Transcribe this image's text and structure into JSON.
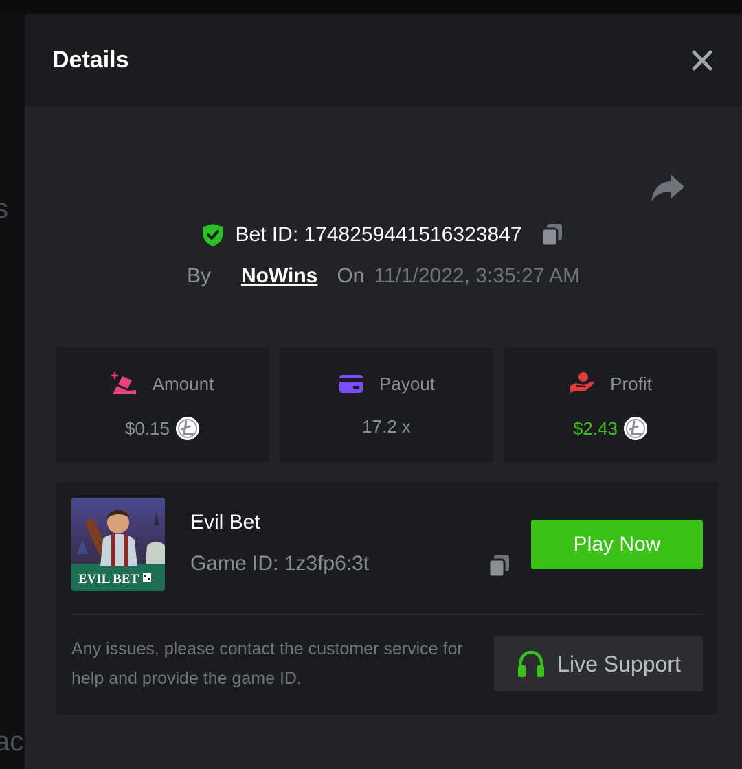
{
  "backdrop": {
    "fragment_top": "s",
    "fragment_bottom": "ac"
  },
  "modal": {
    "title": "Details",
    "close_icon": "close-icon",
    "share_icon": "share-arrow-icon"
  },
  "bet": {
    "id_label": "Bet ID: 1748259441516323847",
    "by_label": "By",
    "user": "NoWins",
    "on_label": "On",
    "date": "11/1/2022, 3:35:27 AM",
    "verified_icon": "shield-check-icon",
    "copy_icon": "copy-icon"
  },
  "stats": [
    {
      "label": "Amount",
      "value": "$0.15",
      "icon": "bet-amount-icon",
      "coin_icon": "litecoin-icon",
      "accent": "#e8437c"
    },
    {
      "label": "Payout",
      "value": "17.2 x",
      "icon": "card-icon",
      "accent": "#7b4cff"
    },
    {
      "label": "Profit",
      "value": "$2.43",
      "icon": "hand-profit-icon",
      "coin_icon": "litecoin-icon",
      "accent": "#e03a3a",
      "value_color": "#3bc117"
    }
  ],
  "game": {
    "name": "Evil Bet",
    "id_label": "Game ID: 1z3fp6:3t",
    "thumb_text": "EVIL BET",
    "play_label": "Play Now",
    "copy_icon": "copy-icon"
  },
  "support": {
    "notice": "Any issues, please contact the customer service for help and provide the game ID.",
    "button_label": "Live Support",
    "icon": "headset-icon"
  },
  "colors": {
    "brand_green": "#3bc117",
    "panel": "#1b1c1f",
    "modal_bg": "#222327"
  }
}
